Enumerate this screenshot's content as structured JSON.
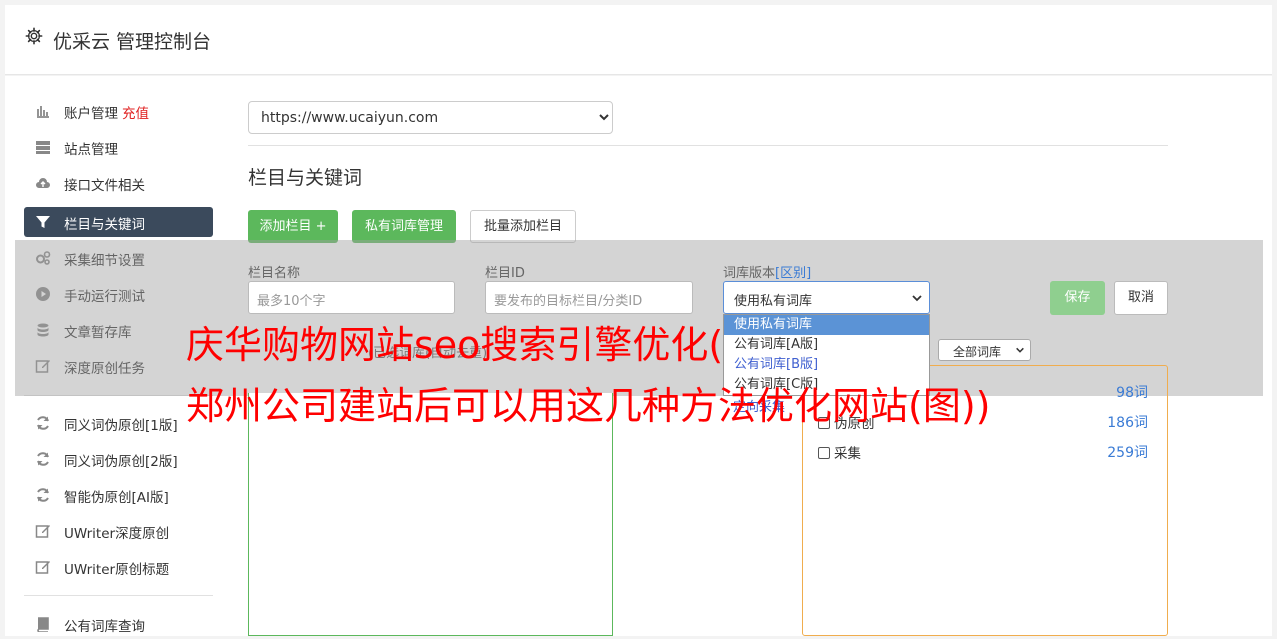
{
  "header": {
    "title": "优采云 管理控制台"
  },
  "sidebar": {
    "items": [
      {
        "label": "账户管理",
        "badge": "充值"
      },
      {
        "label": "站点管理"
      },
      {
        "label": "接口文件相关"
      },
      {
        "label": "栏目与关键词"
      },
      {
        "label": "采集细节设置"
      },
      {
        "label": "手动运行测试"
      },
      {
        "label": "文章暂存库"
      },
      {
        "label": "深度原创任务"
      },
      {
        "label": "同义词伪原创[1版]"
      },
      {
        "label": "同义词伪原创[2版]"
      },
      {
        "label": "智能伪原创[AI版]"
      },
      {
        "label": "UWriter深度原创"
      },
      {
        "label": "UWriter原创标题"
      },
      {
        "label": "公有词库查询"
      }
    ]
  },
  "site_select": {
    "value": "https://www.ucaiyun.com"
  },
  "section_title": "栏目与关键词",
  "buttons": {
    "add_column": "添加栏目 +",
    "private_lib": "私有词库管理",
    "batch_add": "批量添加栏目"
  },
  "form": {
    "name_label": "栏目名称",
    "name_placeholder": "最多10个字",
    "id_label": "栏目ID",
    "id_placeholder": "要发布的目标栏目/分类ID",
    "lib_label": "词库版本",
    "lib_link": "[区别]",
    "lib_value": "使用私有词库",
    "save": "保存",
    "cancel": "取消"
  },
  "dropdown": {
    "options": [
      "使用私有词库",
      "公有词库[A版]",
      "公有词库[B版]",
      "公有词库[C版]",
      "定向采集"
    ]
  },
  "filter": {
    "value": "全部词库"
  },
  "faint_text": "(已选词库(自动去重)",
  "lib_list": [
    {
      "label": "",
      "count": "98词"
    },
    {
      "label": "伪原创",
      "count": "186词"
    },
    {
      "label": "采集",
      "count": "259词"
    }
  ],
  "watermark": {
    "line1": "庆华购物网站seo搜索引擎优化(",
    "line2": "郑州公司建站后可以用这几种方法优化网站(图))"
  },
  "colors": {
    "sidebar_active": "#3b4a5c",
    "green": "#5cb85c",
    "orange": "#f0ad4e",
    "link": "#3a7bd5",
    "red": "#ff0000"
  }
}
